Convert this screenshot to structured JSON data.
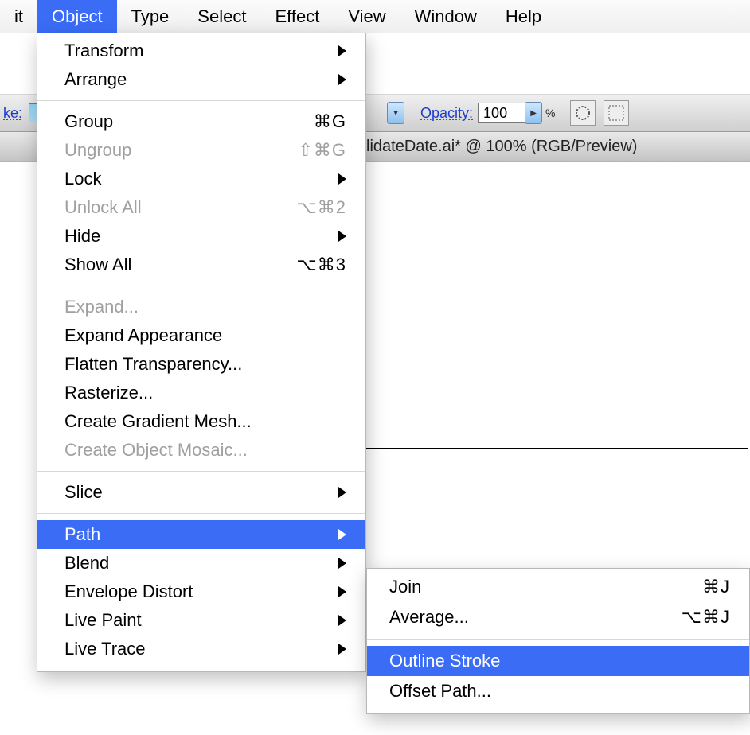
{
  "menubar": {
    "items": [
      {
        "label": "it"
      },
      {
        "label": "Object",
        "selected": true
      },
      {
        "label": "Type"
      },
      {
        "label": "Select"
      },
      {
        "label": "Effect"
      },
      {
        "label": "View"
      },
      {
        "label": "Window"
      },
      {
        "label": "Help"
      }
    ]
  },
  "toolbar": {
    "stroke_label": "ke:",
    "opacity_label": "Opacity:",
    "opacity_value": "100",
    "opacity_unit": "%"
  },
  "document": {
    "title": "lidateDate.ai* @ 100% (RGB/Preview)"
  },
  "object_menu": {
    "items": [
      {
        "label": "Transform",
        "submenu": true
      },
      {
        "label": "Arrange",
        "submenu": true
      },
      {
        "sep": true
      },
      {
        "label": "Group",
        "shortcut": "⌘G"
      },
      {
        "label": "Ungroup",
        "shortcut": "⇧⌘G",
        "disabled": true
      },
      {
        "label": "Lock",
        "submenu": true
      },
      {
        "label": "Unlock All",
        "shortcut": "⌥⌘2",
        "disabled": true
      },
      {
        "label": "Hide",
        "submenu": true
      },
      {
        "label": "Show All",
        "shortcut": "⌥⌘3"
      },
      {
        "sep": true
      },
      {
        "label": "Expand...",
        "disabled": true
      },
      {
        "label": "Expand Appearance"
      },
      {
        "label": "Flatten Transparency..."
      },
      {
        "label": "Rasterize..."
      },
      {
        "label": "Create Gradient Mesh..."
      },
      {
        "label": "Create Object Mosaic...",
        "disabled": true
      },
      {
        "sep": true
      },
      {
        "label": "Slice",
        "submenu": true
      },
      {
        "sep": true
      },
      {
        "label": "Path",
        "submenu": true,
        "highlight": true
      },
      {
        "label": "Blend",
        "submenu": true
      },
      {
        "label": "Envelope Distort",
        "submenu": true
      },
      {
        "label": "Live Paint",
        "submenu": true
      },
      {
        "label": "Live Trace",
        "submenu": true
      }
    ]
  },
  "path_submenu": {
    "items": [
      {
        "label": "Join",
        "shortcut": "⌘J"
      },
      {
        "label": "Average...",
        "shortcut": "⌥⌘J"
      },
      {
        "sep": true
      },
      {
        "label": "Outline Stroke",
        "highlight": true
      },
      {
        "label": "Offset Path..."
      }
    ]
  }
}
